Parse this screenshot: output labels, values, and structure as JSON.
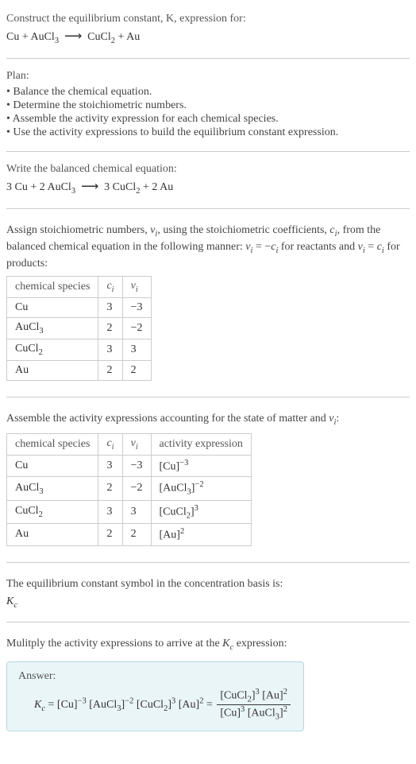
{
  "intro": {
    "title": "Construct the equilibrium constant, K, expression for:",
    "equation_html": "Cu + AuCl<span class='sub'>3</span> &nbsp;<span class='arrow'>⟶</span>&nbsp; CuCl<span class='sub'>2</span> + Au"
  },
  "plan": {
    "heading": "Plan:",
    "items": [
      "• Balance the chemical equation.",
      "• Determine the stoichiometric numbers.",
      "• Assemble the activity expression for each chemical species.",
      "• Use the activity expressions to build the equilibrium constant expression."
    ]
  },
  "balanced": {
    "heading": "Write the balanced chemical equation:",
    "equation_html": "3 Cu + 2 AuCl<span class='sub'>3</span> &nbsp;<span class='arrow'>⟶</span>&nbsp; 3 CuCl<span class='sub'>2</span> + 2 Au"
  },
  "stoich": {
    "para_html": "Assign stoichiometric numbers, <span class='italic'>ν<span class='sub'>i</span></span>, using the stoichiometric coefficients, <span class='italic'>c<span class='sub'>i</span></span>, from the balanced chemical equation in the following manner: <span class='italic'>ν<span class='sub'>i</span></span> = −<span class='italic'>c<span class='sub'>i</span></span> for reactants and <span class='italic'>ν<span class='sub'>i</span></span> = <span class='italic'>c<span class='sub'>i</span></span> for products:",
    "headers": {
      "species": "chemical species",
      "ci_html": "<span class='italic'>c<span class='sub'>i</span></span>",
      "vi_html": "<span class='italic'>ν<span class='sub'>i</span></span>"
    },
    "rows": [
      {
        "species_html": "Cu",
        "ci": "3",
        "vi": "−3"
      },
      {
        "species_html": "AuCl<span class='sub'>3</span>",
        "ci": "2",
        "vi": "−2"
      },
      {
        "species_html": "CuCl<span class='sub'>2</span>",
        "ci": "3",
        "vi": "3"
      },
      {
        "species_html": "Au",
        "ci": "2",
        "vi": "2"
      }
    ]
  },
  "activity": {
    "para_html": "Assemble the activity expressions accounting for the state of matter and <span class='italic'>ν<span class='sub'>i</span></span>:",
    "headers": {
      "species": "chemical species",
      "ci_html": "<span class='italic'>c<span class='sub'>i</span></span>",
      "vi_html": "<span class='italic'>ν<span class='sub'>i</span></span>",
      "activity": "activity expression"
    },
    "rows": [
      {
        "species_html": "Cu",
        "ci": "3",
        "vi": "−3",
        "act_html": "[Cu]<span class='sup'>−3</span>"
      },
      {
        "species_html": "AuCl<span class='sub'>3</span>",
        "ci": "2",
        "vi": "−2",
        "act_html": "[AuCl<span class='sub'>3</span>]<span class='sup'>−2</span>"
      },
      {
        "species_html": "CuCl<span class='sub'>2</span>",
        "ci": "3",
        "vi": "3",
        "act_html": "[CuCl<span class='sub'>2</span>]<span class='sup'>3</span>"
      },
      {
        "species_html": "Au",
        "ci": "2",
        "vi": "2",
        "act_html": "[Au]<span class='sup'>2</span>"
      }
    ]
  },
  "kc_symbol": {
    "para": "The equilibrium constant symbol in the concentration basis is:",
    "symbol_html": "<span class='italic'>K<span class='sub'>c</span></span>"
  },
  "final": {
    "para_html": "Mulitply the activity expressions to arrive at the <span class='italic'>K<span class='sub'>c</span></span> expression:",
    "answer_label": "Answer:",
    "expr_left_html": "<span class='italic'>K<span class='sub'>c</span></span> = [Cu]<span class='sup'>−3</span> [AuCl<span class='sub'>3</span>]<span class='sup'>−2</span> [CuCl<span class='sub'>2</span>]<span class='sup'>3</span> [Au]<span class='sup'>2</span> = ",
    "frac_num_html": "[CuCl<span class='sub'>2</span>]<span class='sup'>3</span> [Au]<span class='sup'>2</span>",
    "frac_den_html": "[Cu]<span class='sup'>3</span> [AuCl<span class='sub'>3</span>]<span class='sup'>2</span>"
  }
}
